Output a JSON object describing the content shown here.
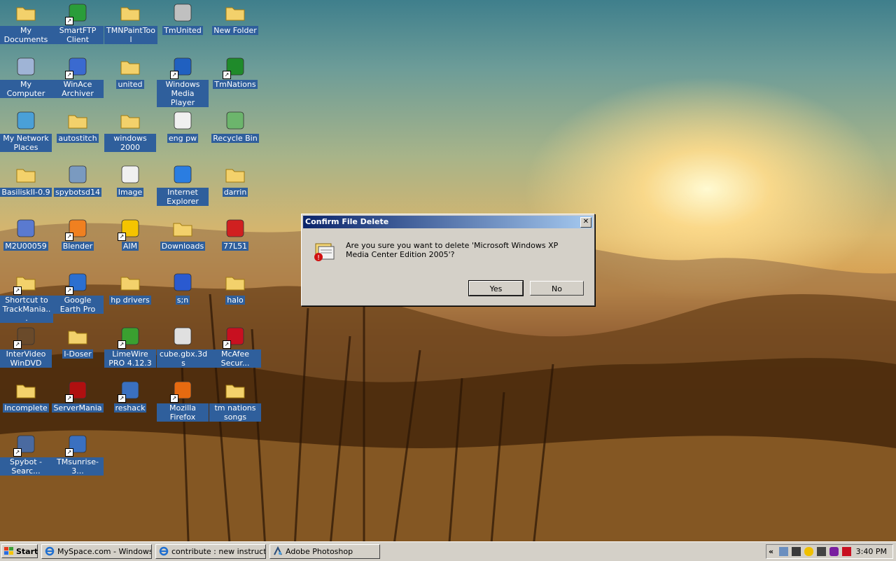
{
  "desktop": {
    "icons": [
      {
        "label": "My Documents",
        "icon": "my-documents-icon"
      },
      {
        "label": "SmartFTP Client",
        "icon": "smartftp-icon",
        "shortcut": true
      },
      {
        "label": "TMNPaintTool",
        "icon": "folder-icon"
      },
      {
        "label": "TmUnited",
        "icon": "tmunited-icon"
      },
      {
        "label": "New Folder",
        "icon": "folder-icon"
      },
      {
        "label": "My Computer",
        "icon": "my-computer-icon"
      },
      {
        "label": "WinAce Archiver",
        "icon": "winace-icon",
        "shortcut": true
      },
      {
        "label": "united",
        "icon": "folder-icon"
      },
      {
        "label": "Windows Media Player",
        "icon": "media-player-icon",
        "shortcut": true
      },
      {
        "label": "TmNations",
        "icon": "tmnations-icon",
        "shortcut": true
      },
      {
        "label": "My Network Places",
        "icon": "network-places-icon"
      },
      {
        "label": "autostitch",
        "icon": "folder-icon"
      },
      {
        "label": "windows 2000",
        "icon": "folder-icon"
      },
      {
        "label": "eng pw",
        "icon": "text-document-icon"
      },
      {
        "label": "Recycle Bin",
        "icon": "recycle-bin-icon"
      },
      {
        "label": "BasiliskII-0.9",
        "icon": "folder-icon"
      },
      {
        "label": "spybotsd14",
        "icon": "installer-icon"
      },
      {
        "label": "Image",
        "icon": "image-file-icon"
      },
      {
        "label": "Internet Explorer",
        "icon": "internet-explorer-icon"
      },
      {
        "label": "darrin",
        "icon": "folder-icon"
      },
      {
        "label": "M2U00059",
        "icon": "video-file-icon"
      },
      {
        "label": "Blender",
        "icon": "blender-icon",
        "shortcut": true
      },
      {
        "label": "AIM",
        "icon": "aim-icon",
        "shortcut": true
      },
      {
        "label": "Downloads",
        "icon": "folder-icon"
      },
      {
        "label": "77L51",
        "icon": "car-icon"
      },
      {
        "label": "Shortcut to TrackMania...",
        "icon": "folder-icon",
        "shortcut": true
      },
      {
        "label": "Google Earth Pro",
        "icon": "google-earth-icon",
        "shortcut": true
      },
      {
        "label": "hp drivers",
        "icon": "folder-icon"
      },
      {
        "label": "s;n",
        "icon": "word-document-icon"
      },
      {
        "label": "halo",
        "icon": "folder-icon"
      },
      {
        "label": "InterVideo WinDVD",
        "icon": "windvd-icon",
        "shortcut": true
      },
      {
        "label": "I-Doser",
        "icon": "folder-icon"
      },
      {
        "label": "LimeWire PRO 4.12.3",
        "icon": "limewire-icon",
        "shortcut": true
      },
      {
        "label": "cube.gbx.3ds",
        "icon": "3ds-file-icon"
      },
      {
        "label": "McAfee Secur...",
        "icon": "mcafee-icon",
        "shortcut": true
      },
      {
        "label": "Incomplete",
        "icon": "folder-icon"
      },
      {
        "label": "ServerMania",
        "icon": "servermania-icon",
        "shortcut": true
      },
      {
        "label": "reshack",
        "icon": "reshack-icon",
        "shortcut": true
      },
      {
        "label": "Mozilla Firefox",
        "icon": "firefox-icon",
        "shortcut": true
      },
      {
        "label": "tm nations songs",
        "icon": "folder-icon"
      },
      {
        "label": "Spybot - Searc...",
        "icon": "spybot-icon",
        "shortcut": true
      },
      {
        "label": "TMsunrise-3...",
        "icon": "tmsunrise-icon",
        "shortcut": true
      }
    ]
  },
  "dialog": {
    "title": "Confirm File Delete",
    "close": "✕",
    "message": "Are you sure you want to delete 'Microsoft Windows XP Media Center Edition 2005'?",
    "yes": "Yes",
    "no": "No"
  },
  "taskbar": {
    "start": "Start",
    "tasks": [
      {
        "label": "MySpace.com - Windows..."
      },
      {
        "label": "contribute : new instruct..."
      },
      {
        "label": "Adobe Photoshop"
      }
    ],
    "tray_chevron": "«",
    "clock": "3:40 PM"
  }
}
